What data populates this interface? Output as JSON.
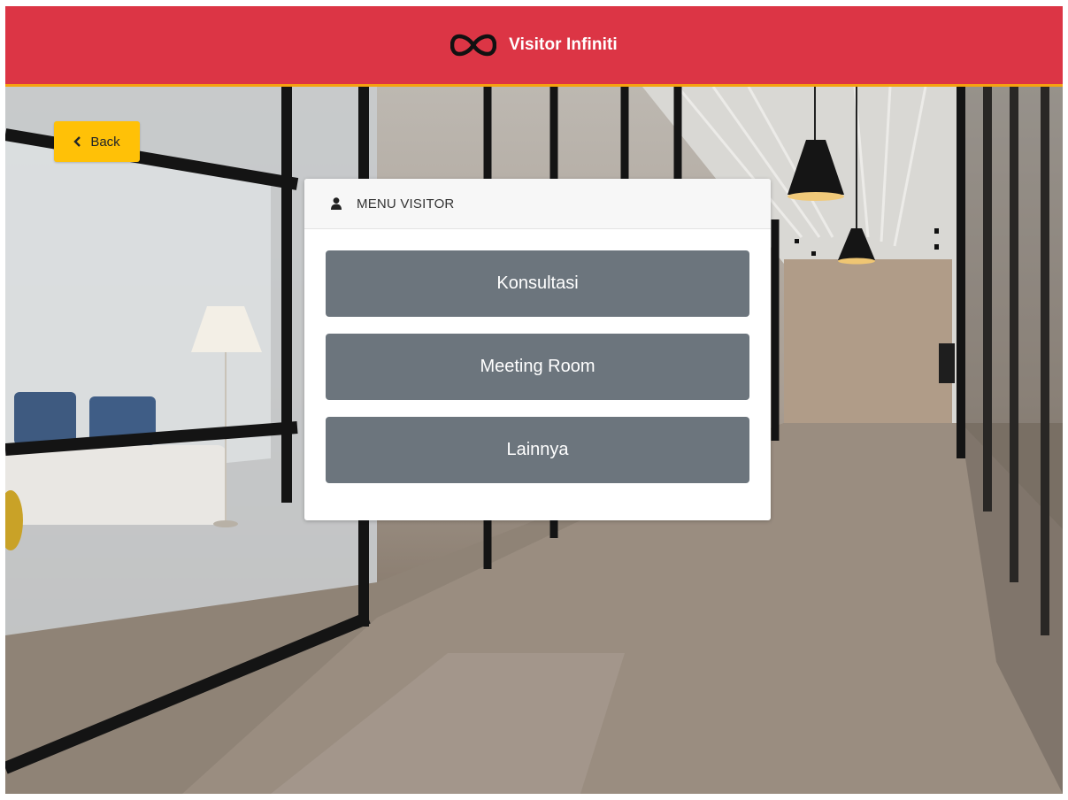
{
  "header": {
    "logo_icon": "infinity-icon",
    "title": "Visitor Infiniti",
    "background_color": "#dc3545",
    "accent_color": "#f5a30f"
  },
  "back_button": {
    "icon": "chevron-left-icon",
    "label": "Back",
    "color": "#ffc107"
  },
  "card": {
    "icon": "user-icon",
    "title": "MENU VISITOR",
    "buttons": [
      {
        "label": "Konsultasi"
      },
      {
        "label": "Meeting Room"
      },
      {
        "label": "Lainnya"
      }
    ],
    "button_color": "#6c757d"
  },
  "background": {
    "image": "office-interior-photo"
  }
}
